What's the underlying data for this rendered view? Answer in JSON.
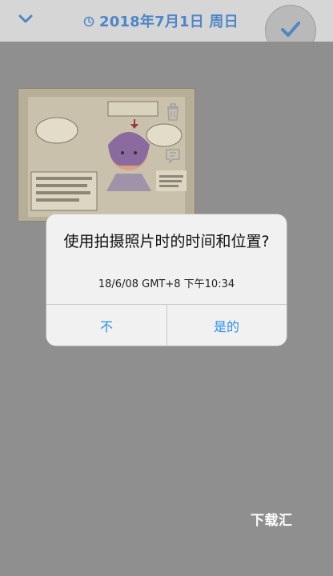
{
  "header": {
    "date": "2018年7月1日 周日"
  },
  "alert": {
    "title": "使用拍摄照片时的时间和位置?",
    "subtitle": "18/6/08 GMT+8 下午10:34",
    "no_label": "不",
    "yes_label": "是的"
  },
  "watermark": "下载汇",
  "icons": {
    "back": "chevron-down-icon",
    "clock": "clock-icon",
    "confirm": "check-icon",
    "delete": "trash-icon",
    "caption": "comment-icon"
  },
  "colors": {
    "accent": "#4f86c6",
    "button_text": "#2f8fe8",
    "overlay": "#8f8f8f"
  }
}
